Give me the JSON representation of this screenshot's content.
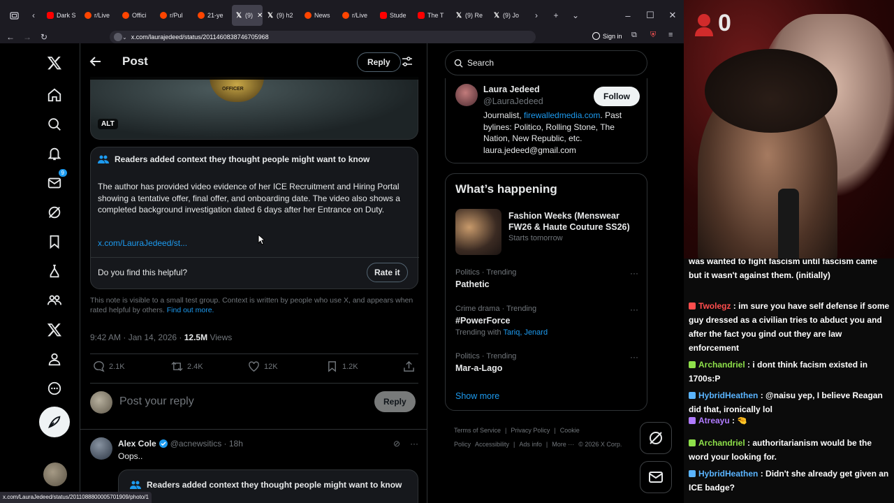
{
  "browser": {
    "tabs": [
      {
        "label": "Dark S",
        "fav": "yt"
      },
      {
        "label": "r/Live",
        "fav": "rd"
      },
      {
        "label": "Offici",
        "fav": "rd"
      },
      {
        "label": "r/Pul",
        "fav": "rd"
      },
      {
        "label": "21-ye",
        "fav": "rd"
      },
      {
        "label": "(9)",
        "fav": "x",
        "active": true
      },
      {
        "label": "(9) h2",
        "fav": "x"
      },
      {
        "label": "News",
        "fav": "rd"
      },
      {
        "label": "r/Live",
        "fav": "rd"
      },
      {
        "label": "Stude",
        "fav": "yt"
      },
      {
        "label": "The T",
        "fav": "yt"
      },
      {
        "label": "(9) Re",
        "fav": "x"
      },
      {
        "label": "(9) Jo",
        "fav": "x"
      }
    ],
    "url": "x.com/laurajedeed/status/2011460838746705968",
    "signin_label": "Sign in",
    "status_url": "x.com/LauraJedeed/status/2011088800005701909/photo/1"
  },
  "leftnav": {
    "messages_badge": "9"
  },
  "header": {
    "title": "Post",
    "reply_label": "Reply"
  },
  "media": {
    "alt_label": "ALT",
    "badge_text": "OFFICER"
  },
  "community_note": {
    "heading": "Readers added context they thought people might want to know",
    "body": "The author has provided video evidence of her ICE Recruitment and Hiring Portal showing a tentative offer, final offer, and onboarding date. The video also shows a completed background investigation dated 6 days after her Entrance on Duty.",
    "link": "x.com/LauraJedeed/st...",
    "question": "Do you find this helpful?",
    "rate_label": "Rate it",
    "visibility": "This note is visible to a small test group. Context is written by people who use X, and appears when rated helpful by others.",
    "find_out": "Find out more."
  },
  "post_meta": {
    "time": "9:42 AM · Jan 14, 2026 · ",
    "views_count": "12.5M",
    "views_label": " Views"
  },
  "actions": {
    "replies": "2.1K",
    "reposts": "2.4K",
    "likes": "12K",
    "bookmarks": "1.2K"
  },
  "reply_box": {
    "placeholder": "Post your reply",
    "button": "Reply"
  },
  "reply_post": {
    "name": "Alex Cole",
    "handle": "@acnewsitics · 18h",
    "text": "Oops..",
    "note_heading": "Readers added context they thought people might want to know"
  },
  "search": {
    "placeholder": "Search"
  },
  "profile": {
    "name": "Laura Jedeed",
    "handle": "@LauraJedeed",
    "follow_label": "Follow",
    "bio_prefix": "Journalist, ",
    "bio_link": "firewalledmedia.com",
    "bio_rest": ". Past bylines: Politico, Rolling Stone, The Nation, New Republic, etc. laura.jedeed@gmail.com"
  },
  "whats_happening": {
    "title": "What’s happening",
    "featured": {
      "title": "Fashion Weeks (Menswear FW26 & Haute Couture SS26)",
      "sub": "Starts tomorrow"
    },
    "trends": [
      {
        "cat": "Politics · Trending",
        "name": "Pathetic",
        "with": ""
      },
      {
        "cat": "Crime drama · Trending",
        "name": "#PowerForce",
        "with_prefix": "Trending with ",
        "with": "Tariq, Jenard"
      },
      {
        "cat": "Politics · Trending",
        "name": "Mar-a-Lago",
        "with": ""
      }
    ],
    "show_more": "Show more"
  },
  "footer": {
    "links": [
      "Terms of Service",
      "|",
      "Privacy Policy",
      "|",
      "Cookie Policy",
      "Accessibility",
      "|",
      "Ads info",
      "|",
      "More ···",
      "© 2026 X Corp."
    ]
  },
  "stream": {
    "viewer_count": "0"
  },
  "chat": {
    "messages": [
      {
        "user": "",
        "color": "#ffffff",
        "text": "was                                                      wanted to fight fascism until fascism came but it wasn't against them. (initially)"
      },
      {
        "user": "Twolegz",
        "color": "#ff4d4d",
        "text": "im sure you have self defense if some guy dressed as a civilian tries to abduct you and after the fact you gind out they are law enforcement"
      },
      {
        "user": "Archandriel",
        "color": "#8ee04a",
        "text": "i dont think facism existed in 1700s:P"
      },
      {
        "user": "HybridHeathen",
        "color": "#5ab4ff",
        "text": "@naisu yep, I believe Reagan did that, ironically lol"
      },
      {
        "user": "Atreayu",
        "color": "#b07bff",
        "text": "🤏"
      },
      {
        "user": "Archandriel",
        "color": "#8ee04a",
        "text": "authoritarianism would be the word your looking for."
      },
      {
        "user": "HybridHeathen",
        "color": "#5ab4ff",
        "text": "Didn't she already get given an ICE badge?"
      }
    ]
  },
  "colors": {
    "accent": "#1d9bf0",
    "bg": "#000000",
    "border": "#2f3336",
    "muted": "#71767b"
  }
}
